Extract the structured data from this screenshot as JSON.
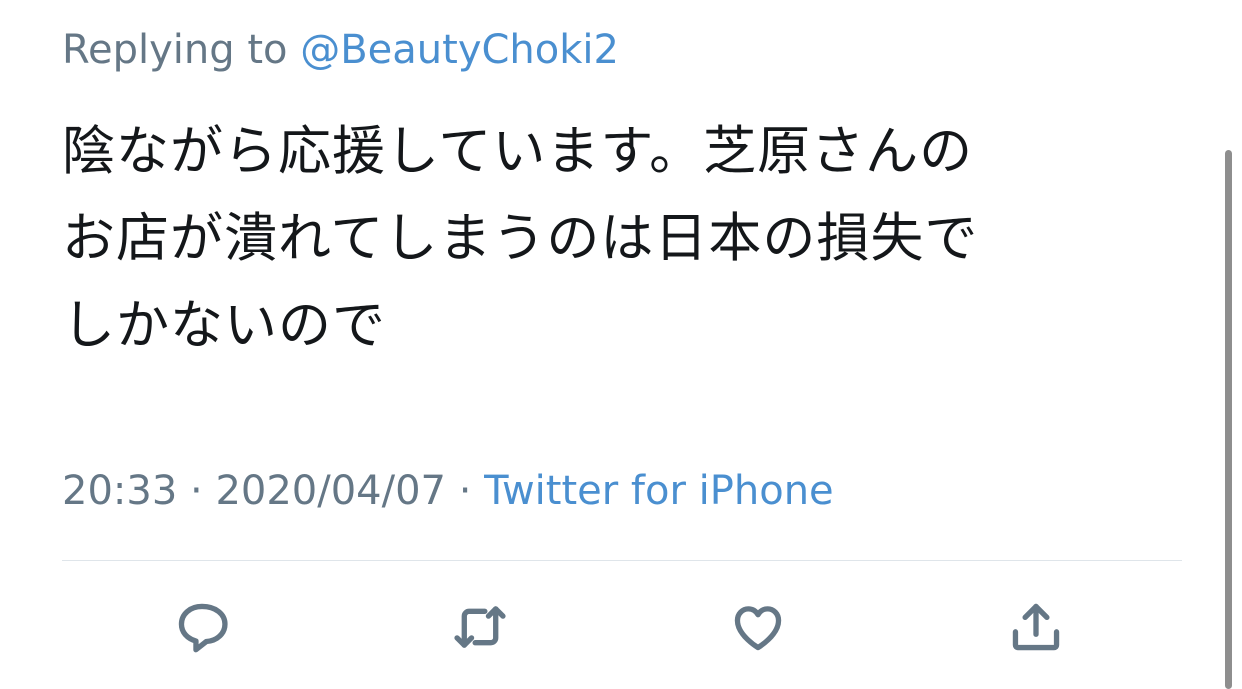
{
  "reply": {
    "prefix": "Replying to",
    "handle": "@BeautyChoki2"
  },
  "tweet": {
    "lines": [
      "陰ながら応援しています。芝原さんの",
      "お店が潰れてしまうのは日本の損失で",
      "しかないので"
    ]
  },
  "meta": {
    "time": "20:33",
    "separator1": "·",
    "date": "2020/04/07",
    "separator2": "·",
    "source": "Twitter for iPhone"
  },
  "actions": [
    {
      "icon": "reply-icon"
    },
    {
      "icon": "retweet-icon"
    },
    {
      "icon": "like-icon"
    },
    {
      "icon": "share-icon"
    }
  ],
  "colors": {
    "text": "#14171a",
    "secondary": "#657786",
    "link": "#4a8fd0",
    "divider": "#dfe5ea"
  }
}
